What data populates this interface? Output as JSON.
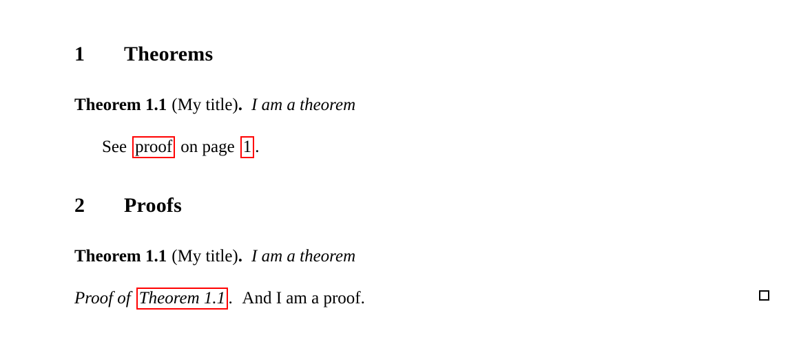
{
  "document": {
    "background_color": "#ffffff",
    "text_color": "#000000",
    "link_box_color": "#FF0000"
  },
  "sections": [
    {
      "number": "1",
      "title": "Theorems"
    },
    {
      "number": "2",
      "title": "Proofs"
    }
  ],
  "theorem_1": {
    "head": "Theorem 1.1",
    "note": "(My title)",
    "period": ".",
    "body": "I am a theorem"
  },
  "theorem_2": {
    "head": "Theorem 1.1",
    "note": "(My title)",
    "period": ".",
    "body": "I am a theorem"
  },
  "reference": {
    "before": "See",
    "link_proof": "proof",
    "middle": "on page",
    "link_page": "1",
    "after": "."
  },
  "proof": {
    "head_before": "Proof of",
    "link_theorem": "Theorem 1.1",
    "head_period": ".",
    "body": "And I am a proof.",
    "qed": "qed-square"
  }
}
